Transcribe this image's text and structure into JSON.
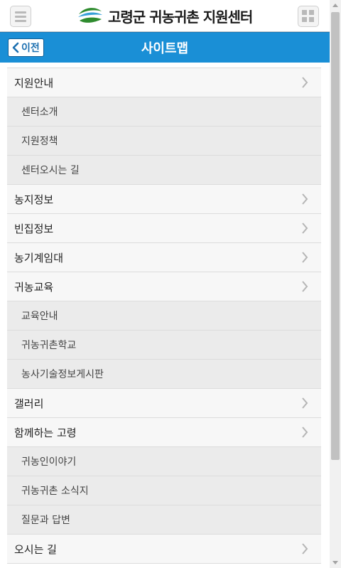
{
  "header": {
    "logo_text": "고령군 귀농귀촌 지원센터",
    "brand_colors": {
      "green": "#2e8b2e",
      "blue": "#1a8fd6"
    }
  },
  "titlebar": {
    "back_label": "이전",
    "title": "사이트맵",
    "color": "#1a8fd6"
  },
  "sitemap": {
    "items": [
      {
        "label": "지원안내",
        "level": "main",
        "icon": "chevron-right-icon"
      },
      {
        "label": "센터소개",
        "level": "sub"
      },
      {
        "label": "지원정책",
        "level": "sub"
      },
      {
        "label": "센터오시는 길",
        "level": "sub"
      },
      {
        "label": "농지정보",
        "level": "main",
        "icon": "chevron-right-icon"
      },
      {
        "label": "빈집정보",
        "level": "main",
        "icon": "chevron-right-icon"
      },
      {
        "label": "농기계임대",
        "level": "main",
        "icon": "chevron-right-icon"
      },
      {
        "label": "귀농교육",
        "level": "main",
        "icon": "chevron-right-icon"
      },
      {
        "label": "교육안내",
        "level": "sub"
      },
      {
        "label": "귀농귀촌학교",
        "level": "sub"
      },
      {
        "label": "농사기술정보게시판",
        "level": "sub"
      },
      {
        "label": "갤러리",
        "level": "main",
        "icon": "chevron-right-icon"
      },
      {
        "label": "함께하는 고령",
        "level": "main",
        "icon": "chevron-right-icon"
      },
      {
        "label": "귀농인이야기",
        "level": "sub"
      },
      {
        "label": "귀농귀촌 소식지",
        "level": "sub"
      },
      {
        "label": "질문과 답변",
        "level": "sub"
      },
      {
        "label": "오시는 길",
        "level": "main",
        "icon": "chevron-right-icon"
      }
    ]
  }
}
